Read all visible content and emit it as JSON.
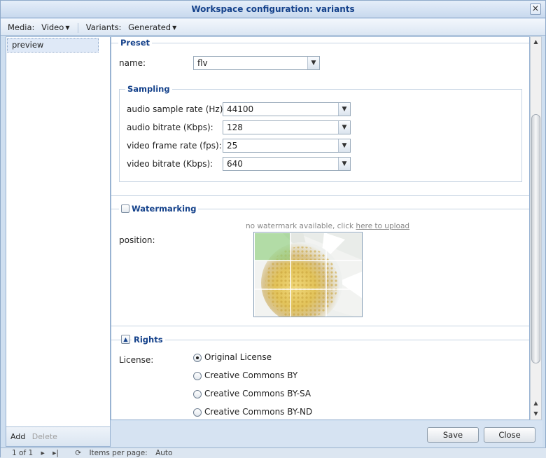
{
  "window": {
    "title": "Workspace configuration: variants",
    "close_glyph": "×"
  },
  "toolbar": {
    "media_label": "Media:",
    "media_value": "Video",
    "variants_label": "Variants:",
    "variants_value": "Generated"
  },
  "left": {
    "items": [
      {
        "label": "preview"
      }
    ],
    "add_label": "Add",
    "delete_label": "Delete"
  },
  "preset": {
    "legend": "Preset",
    "name_label": "name:",
    "name_value": "flv",
    "sampling": {
      "legend": "Sampling",
      "fields": [
        {
          "label": "audio sample rate (Hz):",
          "value": "44100"
        },
        {
          "label": "audio bitrate (Kbps):",
          "value": "128"
        },
        {
          "label": "video frame rate (fps):",
          "value": "25"
        },
        {
          "label": "video bitrate (Kbps):",
          "value": "640"
        }
      ]
    }
  },
  "watermarking": {
    "legend": "Watermarking",
    "checked": false,
    "hint_text": "no watermark available, click ",
    "hint_link": "here to upload",
    "position_label": "position:"
  },
  "rights": {
    "legend": "Rights",
    "license_label": "License:",
    "options": [
      {
        "label": "Original License",
        "selected": true
      },
      {
        "label": "Creative Commons BY",
        "selected": false
      },
      {
        "label": "Creative Commons BY-SA",
        "selected": false
      },
      {
        "label": "Creative Commons BY-ND",
        "selected": false
      }
    ]
  },
  "buttons": {
    "save_label": "Save",
    "close_label": "Close"
  },
  "pager": {
    "page_text": "1 of 1",
    "items_label": "Items per page:",
    "items_value": "Auto"
  },
  "colors": {
    "title_text": "#15428b",
    "panel_border": "#99b3d2",
    "legend_text": "#15428b"
  }
}
